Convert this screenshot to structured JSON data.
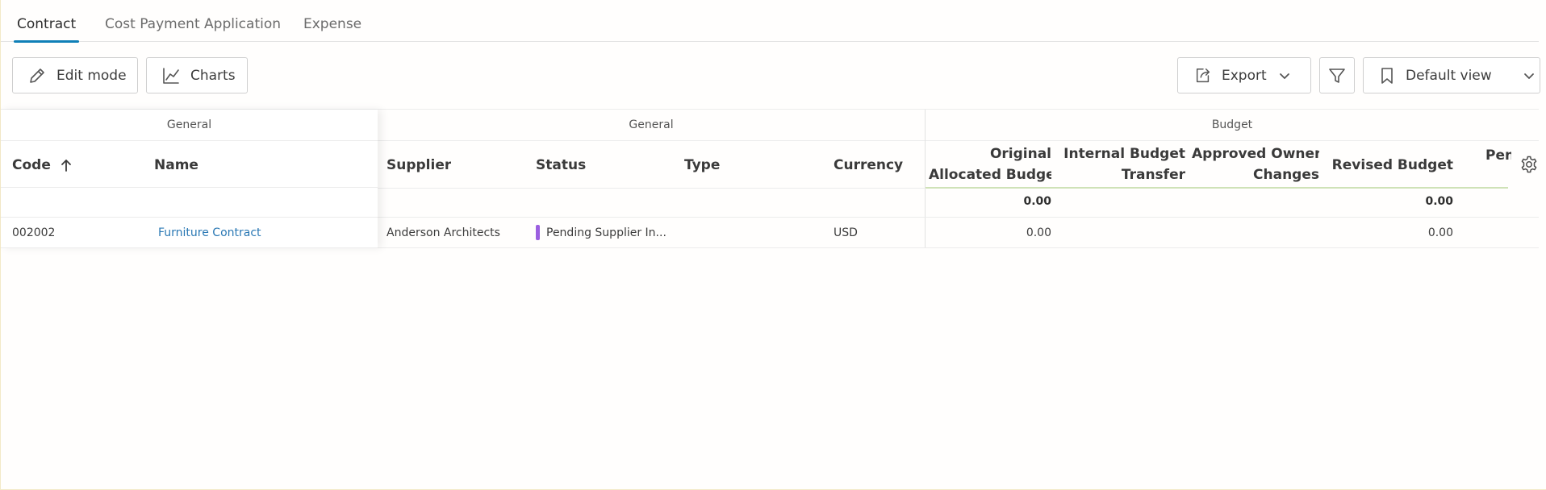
{
  "tabs": [
    {
      "label": "Contract",
      "active": true
    },
    {
      "label": "Cost Payment Application",
      "active": false
    },
    {
      "label": "Expense",
      "active": false
    }
  ],
  "toolbar": {
    "edit_mode_label": "Edit mode",
    "charts_label": "Charts",
    "export_label": "Export",
    "view_label": "Default view"
  },
  "grid": {
    "group_headers": {
      "pinned_general": "General",
      "general": "General",
      "budget": "Budget"
    },
    "columns": {
      "code": "Code",
      "name": "Name",
      "supplier": "Supplier",
      "status": "Status",
      "type": "Type",
      "currency": "Currency",
      "original_allocated_budget": [
        "Original",
        "Allocated Budget"
      ],
      "internal_budget_transfer": [
        "Internal Budget",
        "Transfer"
      ],
      "approved_owner_changes": [
        "Approved Owner",
        "Changes"
      ],
      "revised_budget": "Revised Budget",
      "pending_truncated": "Pen"
    },
    "totals": {
      "original_allocated_budget": "0.00",
      "revised_budget": "0.00"
    },
    "rows": [
      {
        "code": "002002",
        "name": "Furniture Contract",
        "supplier": "Anderson Architects",
        "status": "Pending Supplier In...",
        "type": "",
        "currency": "USD",
        "original_allocated_budget": "0.00",
        "internal_budget_transfer": "",
        "approved_owner_changes": "",
        "revised_budget": "0.00"
      }
    ]
  },
  "colors": {
    "accent": "#0f7fb7",
    "link": "#2a78b4",
    "status_pending": "#9b5fe0",
    "sort_underline": "#cfe2b7"
  },
  "icons": {
    "edit": "pencil-icon",
    "charts": "line-chart-icon",
    "export": "export-icon",
    "filter": "filter-icon",
    "view": "bookmark-icon",
    "settings": "gear-icon",
    "sort": "arrow-up-icon"
  }
}
